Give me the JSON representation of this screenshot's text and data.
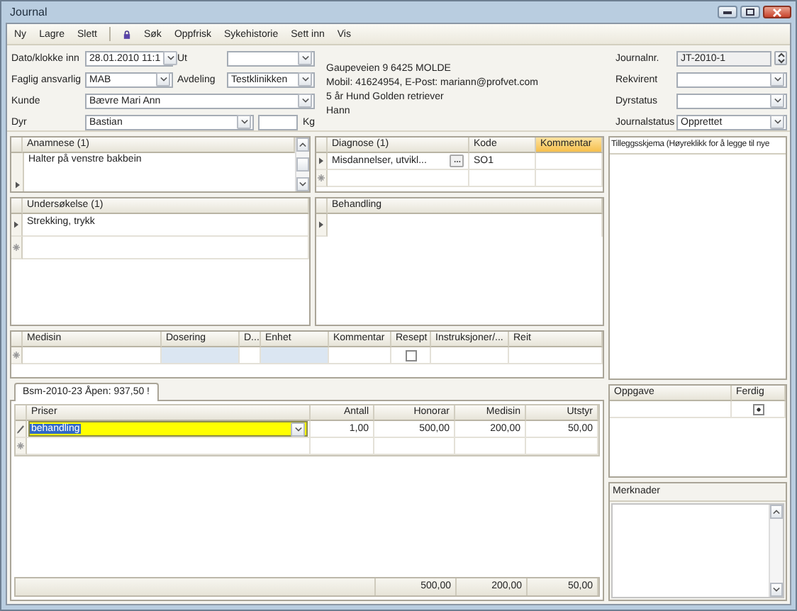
{
  "window": {
    "title": "Journal"
  },
  "menu": {
    "left": [
      "Ny",
      "Lagre",
      "Slett"
    ],
    "right": [
      "Søk",
      "Oppfrisk",
      "Sykehistorie",
      "Sett inn",
      "Vis"
    ]
  },
  "header": {
    "dato": {
      "label": "Dato/klokke inn",
      "value": "28.01.2010 11:1"
    },
    "ut": {
      "label": "Ut"
    },
    "faglig": {
      "label": "Faglig ansvarlig",
      "value": "MAB"
    },
    "avdeling": {
      "label": "Avdeling",
      "value": "Testklinikken"
    },
    "kunde": {
      "label": "Kunde",
      "value": "Bævre Mari Ann"
    },
    "dyr": {
      "label": "Dyr",
      "value": "Bastian"
    },
    "weight_unit": "Kg",
    "info_lines": [
      "Gaupeveien 9 6425 MOLDE",
      "Mobil: 41624954, E-Post: mariann@profvet.com",
      "5 år Hund Golden retriever",
      "Hann"
    ],
    "right_fields": [
      {
        "label": "Journalnr.",
        "value": "JT-2010-1",
        "kind": "spin"
      },
      {
        "label": "Rekvirent",
        "kind": "combo"
      },
      {
        "label": "Dyrstatus",
        "kind": "combo"
      },
      {
        "label": "Journalstatus",
        "value": "Opprettet",
        "kind": "combo"
      }
    ]
  },
  "anamnese": {
    "title": "Anamnese (1)",
    "rows": [
      "Halter på venstre bakbein"
    ]
  },
  "diagnose": {
    "columns": [
      {
        "label": "Diagnose (1)",
        "highlighted": false
      },
      {
        "label": "Kode",
        "highlighted": false
      },
      {
        "label": "Kommentar",
        "highlighted": true
      }
    ],
    "rows": [
      {
        "diagnose": "Misdannelser, utvikl...",
        "kode": "SO1"
      }
    ]
  },
  "undersokelse": {
    "title": "Undersøkelse (1)",
    "rows": [
      "Strekking, trykk"
    ]
  },
  "behandling": {
    "title": "Behandling"
  },
  "medisin": {
    "columns": [
      "Medisin",
      "Dosering",
      "D...",
      "Enhet",
      "Kommentar",
      "Resept",
      "Instruksjoner/...",
      "Reit"
    ],
    "new_row": {
      "resept_checked": false
    }
  },
  "tabs": [
    {
      "label": "Bsm-2010-23 Åpen: 937,50 !",
      "selected": true
    }
  ],
  "priser": {
    "columns": [
      "Priser",
      "Antall",
      "Honorar",
      "Medisin",
      "Utstyr"
    ],
    "rows": [
      {
        "item": "behandling",
        "antall": "1,00",
        "honorar": "500,00",
        "medisin": "200,00",
        "utstyr": "50,00",
        "selected": true
      }
    ],
    "totals": [
      "500,00",
      "200,00",
      "50,00"
    ]
  },
  "tilleggsskjema": {
    "title": "Tilleggsskjema (Høyreklikk for å legge til nye"
  },
  "oppgave": {
    "columns": [
      "Oppgave",
      "Ferdig"
    ],
    "rows": [
      {
        "ferdig": true
      }
    ]
  },
  "merknader": {
    "label": "Merknader"
  }
}
